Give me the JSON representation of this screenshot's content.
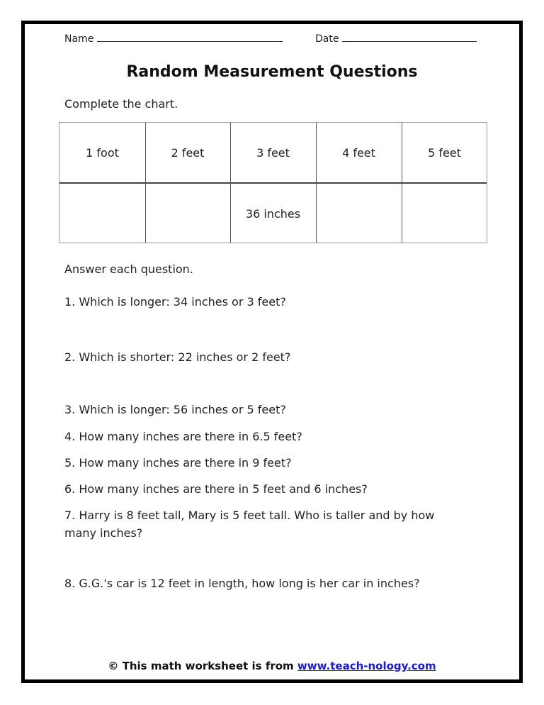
{
  "header": {
    "name_label": "Name",
    "date_label": "Date"
  },
  "title": "Random Measurement Questions",
  "chart_section": {
    "instruction": "Complete the chart.",
    "table": {
      "headers": [
        "1 foot",
        "2 feet",
        "3 feet",
        "4 feet",
        "5 feet"
      ],
      "answers": [
        "",
        "",
        "36 inches",
        "",
        ""
      ]
    }
  },
  "questions_section": {
    "instruction": "Answer each question.",
    "questions": [
      "1. Which is longer: 34 inches or 3 feet?",
      "2. Which is shorter: 22 inches or 2 feet?",
      "3. Which is longer: 56 inches or 5 feet?",
      "4. How many inches are there in 6.5 feet?",
      "5. How many inches are there in 9 feet?",
      "6. How many inches are there in 5 feet and 6 inches?",
      "7. Harry is 8 feet tall, Mary is 5 feet tall. Who is taller and by how",
      "many inches?",
      "8. G.G.'s car is 12 feet in length, how long is her car in inches?"
    ]
  },
  "footer": {
    "copyright_symbol": "©",
    "text": "This math worksheet is from",
    "link_text": "www.teach-nology.com"
  },
  "colors": {
    "link": "#1a1adc",
    "border": "#000000"
  }
}
